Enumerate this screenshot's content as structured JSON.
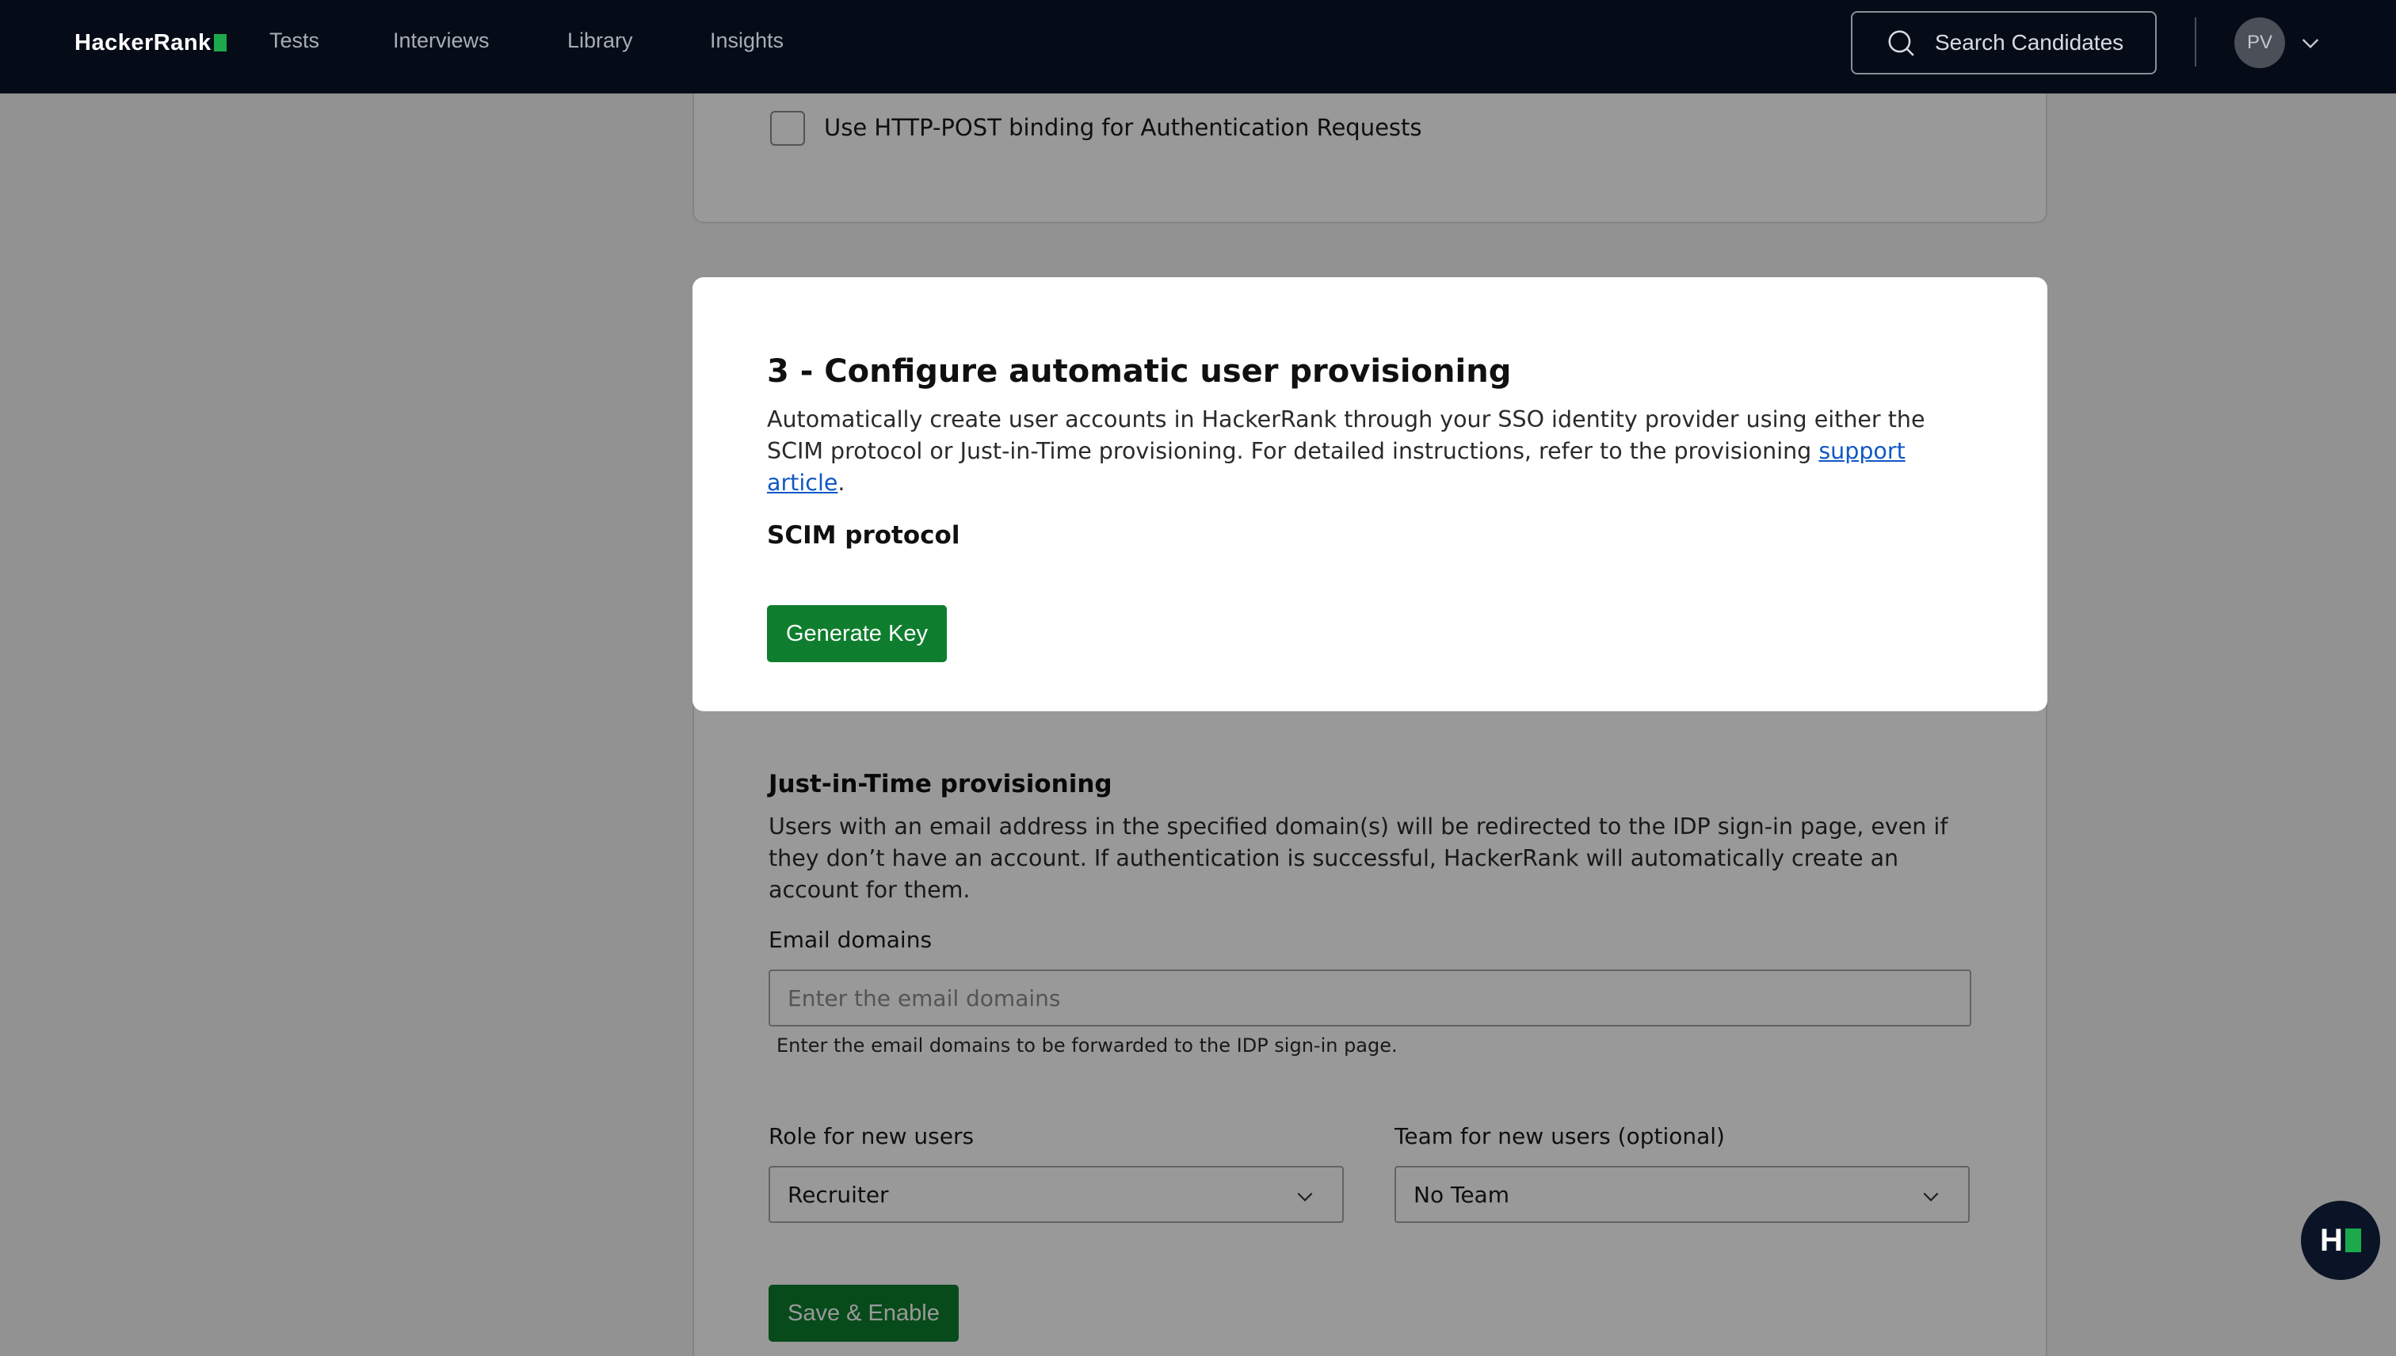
{
  "nav": {
    "logo": "HackerRank",
    "tabs": [
      "Tests",
      "Interviews",
      "Library",
      "Insights"
    ],
    "search_label": "Search Candidates",
    "avatar_initials": "PV"
  },
  "saml": {
    "checkbox_label": "Use HTTP-POST binding for Authentication Requests",
    "checkbox_checked": false
  },
  "provisioning": {
    "title": "3 - Configure automatic user provisioning",
    "description": "Automatically create user accounts in HackerRank through your SSO identity provider using either the SCIM protocol or Just-in-Time provisioning. For detailed instructions, refer to the provisioning ",
    "link_text": "support article",
    "description_end": ".",
    "scim": {
      "heading": "SCIM protocol",
      "button": "Generate Key"
    },
    "jit": {
      "heading": "Just-in-Time provisioning",
      "description": "Users with an email address in the specified domain(s) will be redirected to the IDP sign-in page, even if they don’t have an account. If authentication is successful, HackerRank will automatically create an account for them.",
      "email_label": "Email domains",
      "email_placeholder": "Enter the email domains",
      "email_value": "",
      "email_help": "Enter the email domains to be forwarded to the IDP sign-in page.",
      "role_label": "Role for new users",
      "role_value": "Recruiter",
      "team_label": "Team for new users (optional)",
      "team_value": "No Team",
      "save_button": "Save & Enable"
    }
  },
  "colors": {
    "nav_bg": "#050c18",
    "brand_green": "#1ba94c",
    "button_green": "#0e7e2e",
    "link_blue": "#1058c6"
  },
  "icons": {
    "search": "search-icon",
    "avatar_menu": "chevron-down-icon",
    "select": "chevron-down-icon",
    "help_widget": "hackerrank-logo-icon"
  }
}
